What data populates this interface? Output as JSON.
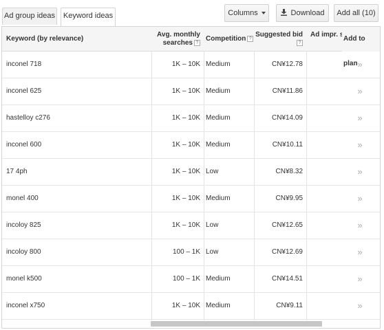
{
  "tabs": [
    {
      "label": "Ad group ideas"
    },
    {
      "label": "Keyword ideas"
    }
  ],
  "toolbar": {
    "columns_label": "Columns",
    "download_label": "Download",
    "add_all_label": "Add all (10)"
  },
  "header": {
    "keyword": "Keyword (by relevance)",
    "avg_line1": "Avg. monthly",
    "avg_line2": "searches",
    "competition": "Competition",
    "bid_line1": "Suggested bid",
    "impr": "Ad impr. s",
    "add_to_plan": "Add to plan",
    "help": "?"
  },
  "add_glyph": "»",
  "rows": [
    {
      "keyword": "inconel 718",
      "avg": "1K – 10K",
      "competition": "Medium",
      "bid": "CN¥12.78"
    },
    {
      "keyword": "inconel 625",
      "avg": "1K – 10K",
      "competition": "Medium",
      "bid": "CN¥11.86"
    },
    {
      "keyword": "hastelloy c276",
      "avg": "1K – 10K",
      "competition": "Medium",
      "bid": "CN¥14.09"
    },
    {
      "keyword": "inconel 600",
      "avg": "1K – 10K",
      "competition": "Medium",
      "bid": "CN¥10.11"
    },
    {
      "keyword": "17 4ph",
      "avg": "1K – 10K",
      "competition": "Low",
      "bid": "CN¥8.32"
    },
    {
      "keyword": "monel 400",
      "avg": "1K – 10K",
      "competition": "Medium",
      "bid": "CN¥9.95"
    },
    {
      "keyword": "incoloy 825",
      "avg": "1K – 10K",
      "competition": "Low",
      "bid": "CN¥12.65"
    },
    {
      "keyword": "incoloy 800",
      "avg": "100 – 1K",
      "competition": "Low",
      "bid": "CN¥12.69"
    },
    {
      "keyword": "monel k500",
      "avg": "100 – 1K",
      "competition": "Medium",
      "bid": "CN¥14.51"
    },
    {
      "keyword": "inconel x750",
      "avg": "1K – 10K",
      "competition": "Medium",
      "bid": "CN¥9.11"
    }
  ]
}
